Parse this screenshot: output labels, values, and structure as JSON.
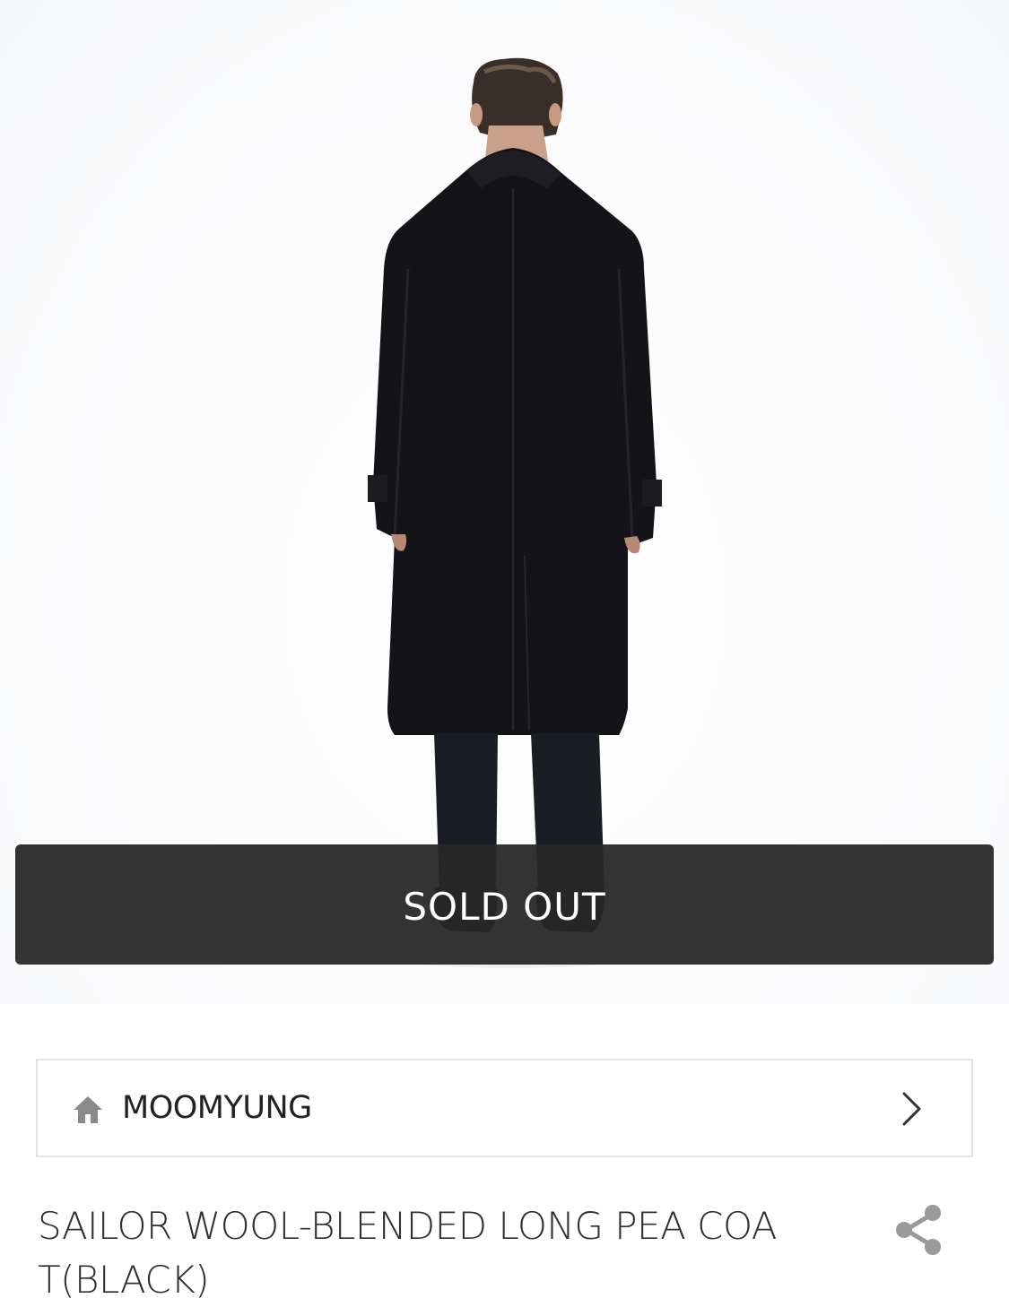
{
  "product": {
    "status_label": "SOLD OUT",
    "title_line1": "SAILOR WOOL-BLENDED LONG PEA COA",
    "title_line2": "T(BLACK)"
  },
  "brand": {
    "name": "MOOMYUNG"
  },
  "icons": {
    "home": "home-icon",
    "chevron": "chevron-right-icon",
    "share": "share-icon"
  },
  "colors": {
    "soldout_bg": "#282828",
    "text": "#2f2f2f",
    "icon_gray": "#8a8a8a",
    "border": "#e3e3e3"
  }
}
